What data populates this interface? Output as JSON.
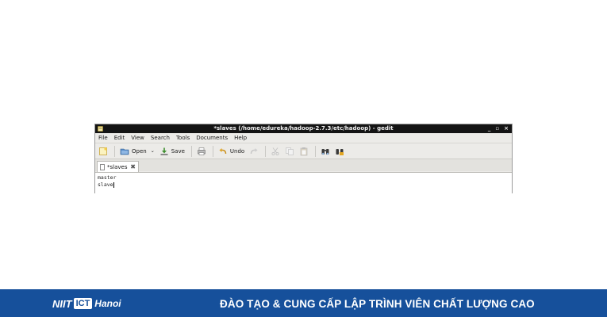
{
  "window": {
    "title": "*slaves (/home/edureka/hadoop-2.7.3/etc/hadoop) - gedit",
    "controls": {
      "minimize": "_",
      "maximize": "▫",
      "close": "×"
    }
  },
  "menu": {
    "file": "File",
    "edit": "Edit",
    "view": "View",
    "search": "Search",
    "tools": "Tools",
    "documents": "Documents",
    "help": "Help"
  },
  "toolbar": {
    "open_label": "Open",
    "save_label": "Save",
    "undo_label": "Undo"
  },
  "tab": {
    "label": "*slaves",
    "close": "✖"
  },
  "editor": {
    "lines": [
      "master",
      "slave"
    ]
  },
  "footer": {
    "logo_left": "NIIT",
    "logo_box": "ICT",
    "logo_right": "Hanoi",
    "slogan": "ĐÀO TẠO & CUNG CẤP LẬP TRÌNH VIÊN CHẤT LƯỢNG CAO",
    "bg_color": "#16509b"
  }
}
